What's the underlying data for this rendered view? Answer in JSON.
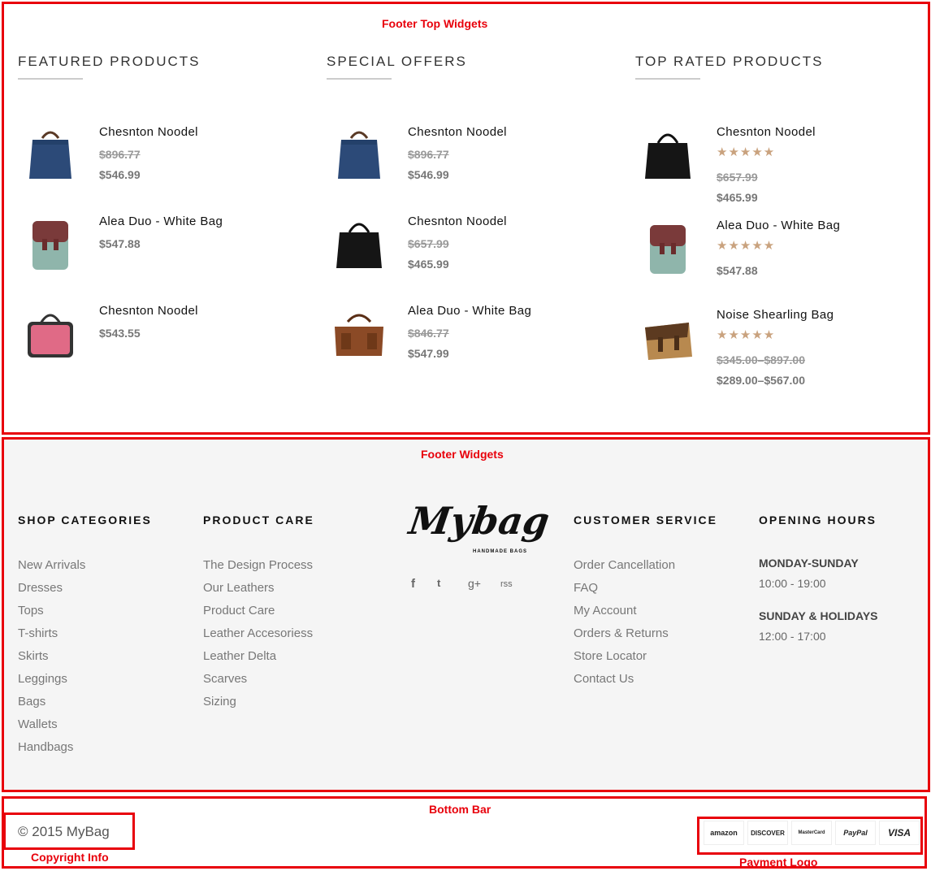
{
  "annotations": {
    "top": "Footer Top Widgets",
    "footer": "Footer Widgets",
    "bottom": "Bottom Bar",
    "copyright": "Copyright Info",
    "payment": "Payment Logo"
  },
  "top_widgets": [
    {
      "title": "FEATURED PRODUCTS",
      "products": [
        {
          "name": "Chesnton Noodel",
          "old": "$896.77",
          "price": "$546.99",
          "image": "blue-tote-icon"
        },
        {
          "name": "Alea Duo - White Bag",
          "old": "",
          "price": "$547.88",
          "image": "backpack-icon"
        },
        {
          "name": "Chesnton Noodel",
          "old": "",
          "price": "$543.55",
          "image": "pink-bag-icon"
        }
      ]
    },
    {
      "title": "SPECIAL OFFERS",
      "products": [
        {
          "name": "Chesnton Noodel",
          "old": "$896.77",
          "price": "$546.99",
          "image": "blue-tote-icon"
        },
        {
          "name": "Chesnton Noodel",
          "old": "$657.99",
          "price": "$465.99",
          "image": "black-tote-icon"
        },
        {
          "name": "Alea Duo - White Bag",
          "old": "$846.77",
          "price": "$547.99",
          "image": "brown-duffel-icon"
        }
      ]
    },
    {
      "title": "TOP RATED PRODUCTS",
      "products": [
        {
          "name": "Chesnton Noodel",
          "stars": "★★★★★",
          "old": "$657.99",
          "price": "$465.99",
          "image": "black-tote-icon"
        },
        {
          "name": "Alea Duo - White Bag",
          "stars": "★★★★★",
          "old": "",
          "price": "$547.88",
          "image": "backpack-icon"
        },
        {
          "name": "Noise Shearling Bag",
          "stars": "★★★★★",
          "old": "$345.00–$897.00",
          "price": "$289.00–$567.00",
          "image": "messenger-bag-icon"
        }
      ]
    }
  ],
  "footer": {
    "shop": {
      "title": "SHOP CATEGORIES",
      "links": [
        "New Arrivals",
        "Dresses",
        "Tops",
        "T-shirts",
        "Skirts",
        "Leggings",
        "Bags",
        "Wallets",
        "Handbags"
      ]
    },
    "care": {
      "title": "PRODUCT CARE",
      "links": [
        "The Design Process",
        "Our Leathers",
        "Product Care",
        "Leather Accesoriess",
        "Leather Delta",
        "Scarves",
        "Sizing"
      ]
    },
    "logo": {
      "text": "Mybag",
      "tagline": "HANDMADE BAGS"
    },
    "social": [
      "f",
      "t",
      "g+",
      "rss"
    ],
    "service": {
      "title": "CUSTOMER SERVICE",
      "links": [
        "Order Cancellation",
        "FAQ",
        "My Account",
        "Orders & Returns",
        "Store Locator",
        "Contact Us"
      ]
    },
    "hours": {
      "title": "OPENING HOURS",
      "label1": "MONDAY-SUNDAY",
      "time1": "10:00 - 19:00",
      "label2": "SUNDAY & HOLIDAYS",
      "time2": "12:00 - 17:00"
    }
  },
  "bottom": {
    "copyright": "© 2015 MyBag",
    "payments": [
      "amazon",
      "DISCOVER",
      "MasterCard",
      "PayPal",
      "VISA"
    ]
  },
  "colors": {
    "annotation": "#e8000b",
    "star": "#c9a27e",
    "footer_bg": "#f5f5f5"
  }
}
